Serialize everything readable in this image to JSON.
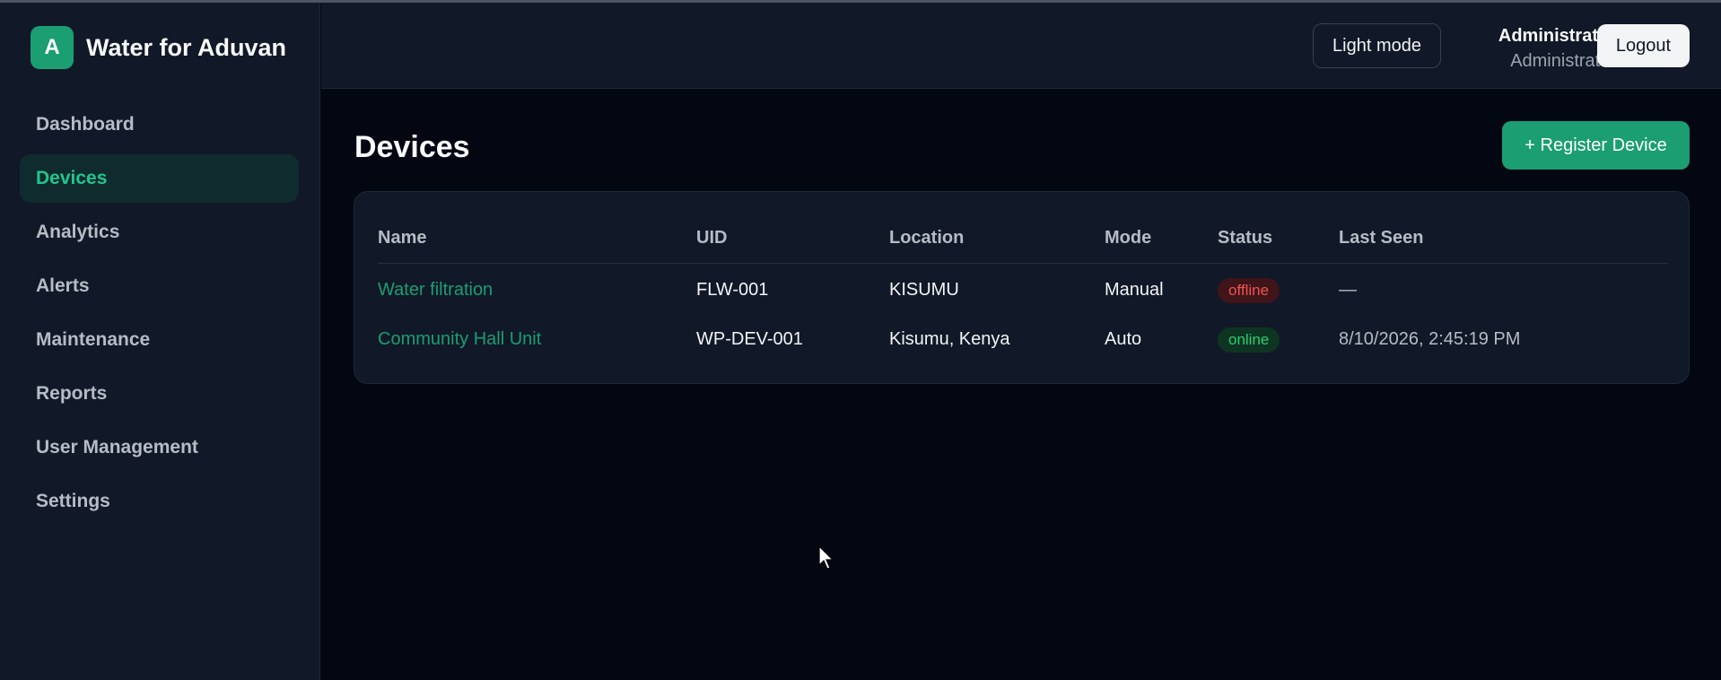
{
  "brand": {
    "logo_letter": "A",
    "name": "Water for Aduvan",
    "accent": "#1a9e72"
  },
  "sidebar": {
    "items": [
      {
        "label": "Dashboard",
        "active": false
      },
      {
        "label": "Devices",
        "active": true
      },
      {
        "label": "Analytics",
        "active": false
      },
      {
        "label": "Alerts",
        "active": false
      },
      {
        "label": "Maintenance",
        "active": false
      },
      {
        "label": "Reports",
        "active": false
      },
      {
        "label": "User Management",
        "active": false
      },
      {
        "label": "Settings",
        "active": false
      }
    ]
  },
  "header": {
    "theme_toggle_label": "Light mode",
    "user_name": "Administrator",
    "user_role": "Administrator",
    "logout_label": "Logout"
  },
  "main": {
    "title": "Devices",
    "register_label": "+ Register Device",
    "table": {
      "columns": [
        "Name",
        "UID",
        "Location",
        "Mode",
        "Status",
        "Last Seen"
      ],
      "rows": [
        {
          "name": "Water filtration",
          "uid": "FLW-001",
          "location": "KISUMU",
          "mode": "Manual",
          "status": "offline",
          "last_seen": "—"
        },
        {
          "name": "Community Hall Unit",
          "uid": "WP-DEV-001",
          "location": "Kisumu, Kenya",
          "mode": "Auto",
          "status": "online",
          "last_seen": "8/10/2026, 2:45:19 PM"
        }
      ]
    }
  },
  "colors": {
    "background": "#030712",
    "panel": "#111827",
    "status_offline": "#ef5350",
    "status_online": "#2ecc71"
  }
}
